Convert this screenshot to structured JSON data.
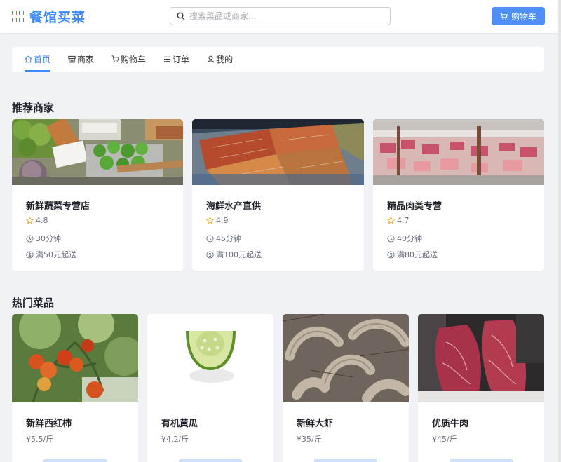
{
  "header": {
    "brand": "餐馆买菜",
    "search_placeholder": "搜索菜品或商家...",
    "cart_label": "购物车"
  },
  "nav": [
    {
      "label": "首页",
      "icon": "home-icon",
      "active": true
    },
    {
      "label": "商家",
      "icon": "store-icon",
      "active": false
    },
    {
      "label": "购物车",
      "icon": "cart-icon",
      "active": false
    },
    {
      "label": "订单",
      "icon": "list-icon",
      "active": false
    },
    {
      "label": "我的",
      "icon": "user-icon",
      "active": false
    }
  ],
  "sections": {
    "recommended": "推荐商家",
    "hot": "热门菜品"
  },
  "shops": [
    {
      "name": "新鲜蔬菜专营店",
      "rating": "4.8",
      "time": "30分钟",
      "min_order": "满50元起送",
      "image": "vegetable-market-photo"
    },
    {
      "name": "海鲜水产直供",
      "rating": "4.9",
      "time": "45分钟",
      "min_order": "满100元起送",
      "image": "seafood-market-photo"
    },
    {
      "name": "精品肉类专营",
      "rating": "4.7",
      "time": "40分钟",
      "min_order": "满80元起送",
      "image": "meat-counter-photo"
    }
  ],
  "dishes": [
    {
      "name": "新鲜西红柿",
      "price": "¥5.5/斤",
      "image": "tomato-photo"
    },
    {
      "name": "有机黄瓜",
      "price": "¥4.2/斤",
      "image": "cucumber-photo"
    },
    {
      "name": "新鲜大虾",
      "price": "¥35/斤",
      "image": "shrimp-photo"
    },
    {
      "name": "优质牛肉",
      "price": "¥45/斤",
      "image": "beef-photo"
    }
  ],
  "colors": {
    "accent": "#3d8bfd",
    "button": "#4f8ff7",
    "background": "#f0f2f5",
    "star": "#f5a623"
  }
}
